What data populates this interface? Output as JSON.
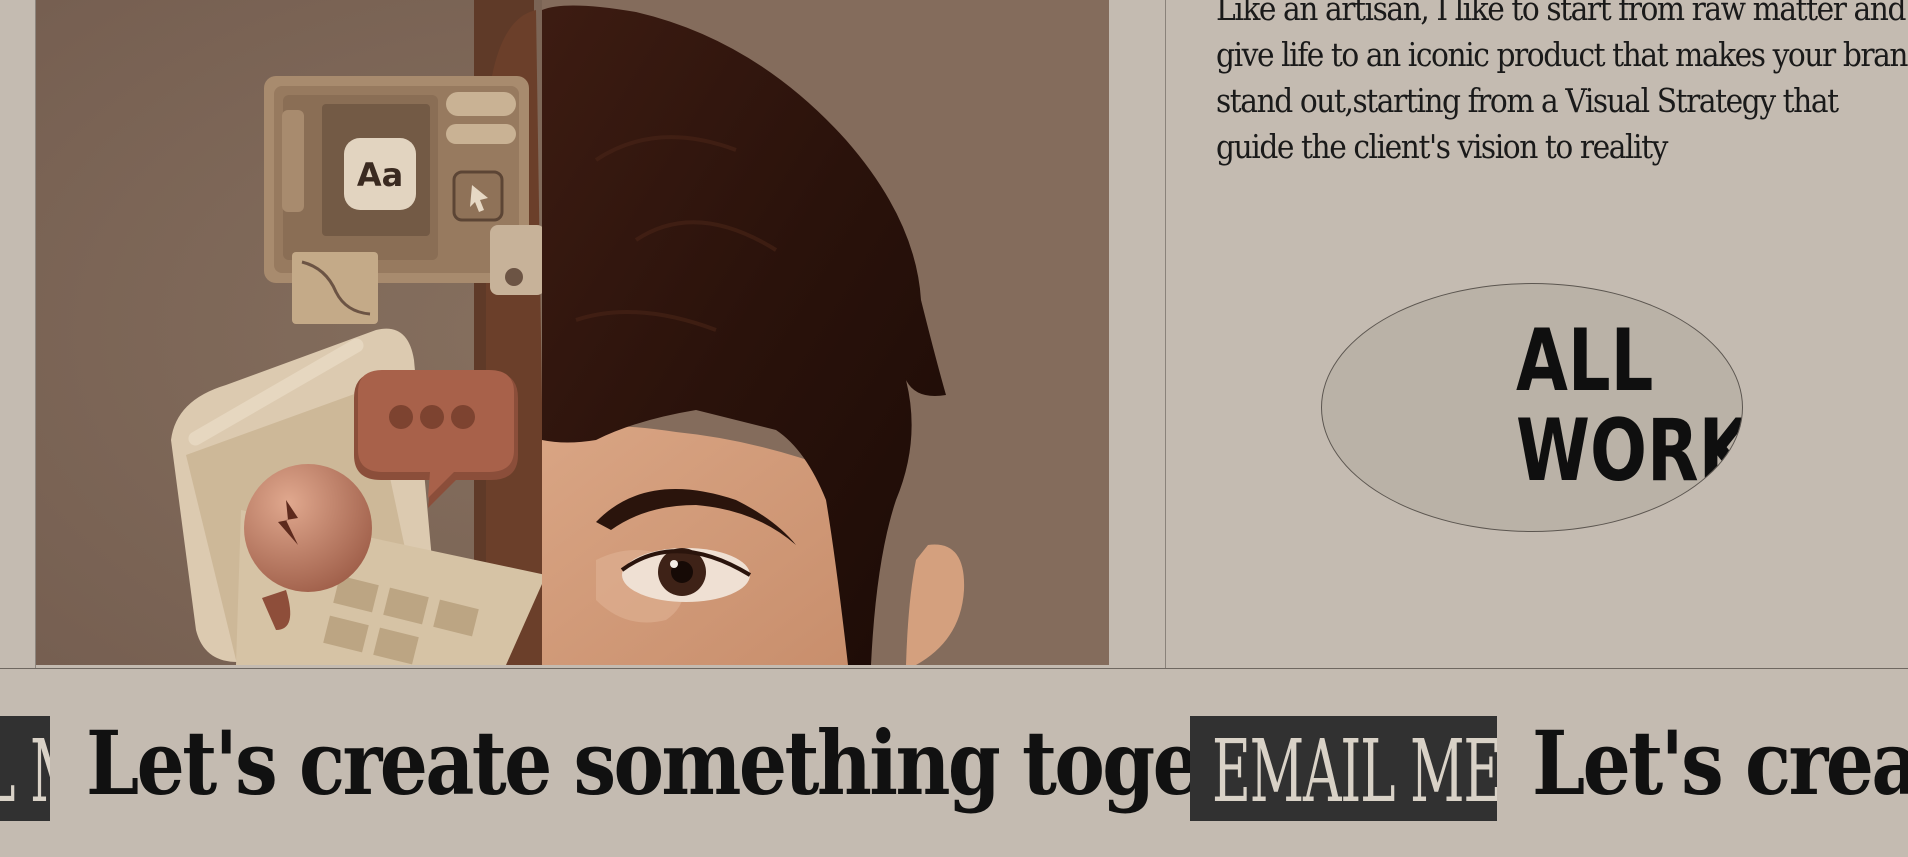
{
  "intro": {
    "lines": [
      "Like an artisan, I like to start from raw matter and",
      "give life to an iconic product that makes your brand",
      "stand out,starting from a Visual Strategy that",
      "guide the client's vision to reality"
    ]
  },
  "all_work": {
    "line1": "ALL",
    "line2": "WORK"
  },
  "marquee": {
    "phrase": "Let's create something together",
    "email_label": "EMAIL ME"
  },
  "hero": {
    "icon_text": "Aa"
  },
  "colors": {
    "page_bg": "#c4bbb1",
    "hero_bg": "#7e685a",
    "email_bg": "#313131"
  }
}
